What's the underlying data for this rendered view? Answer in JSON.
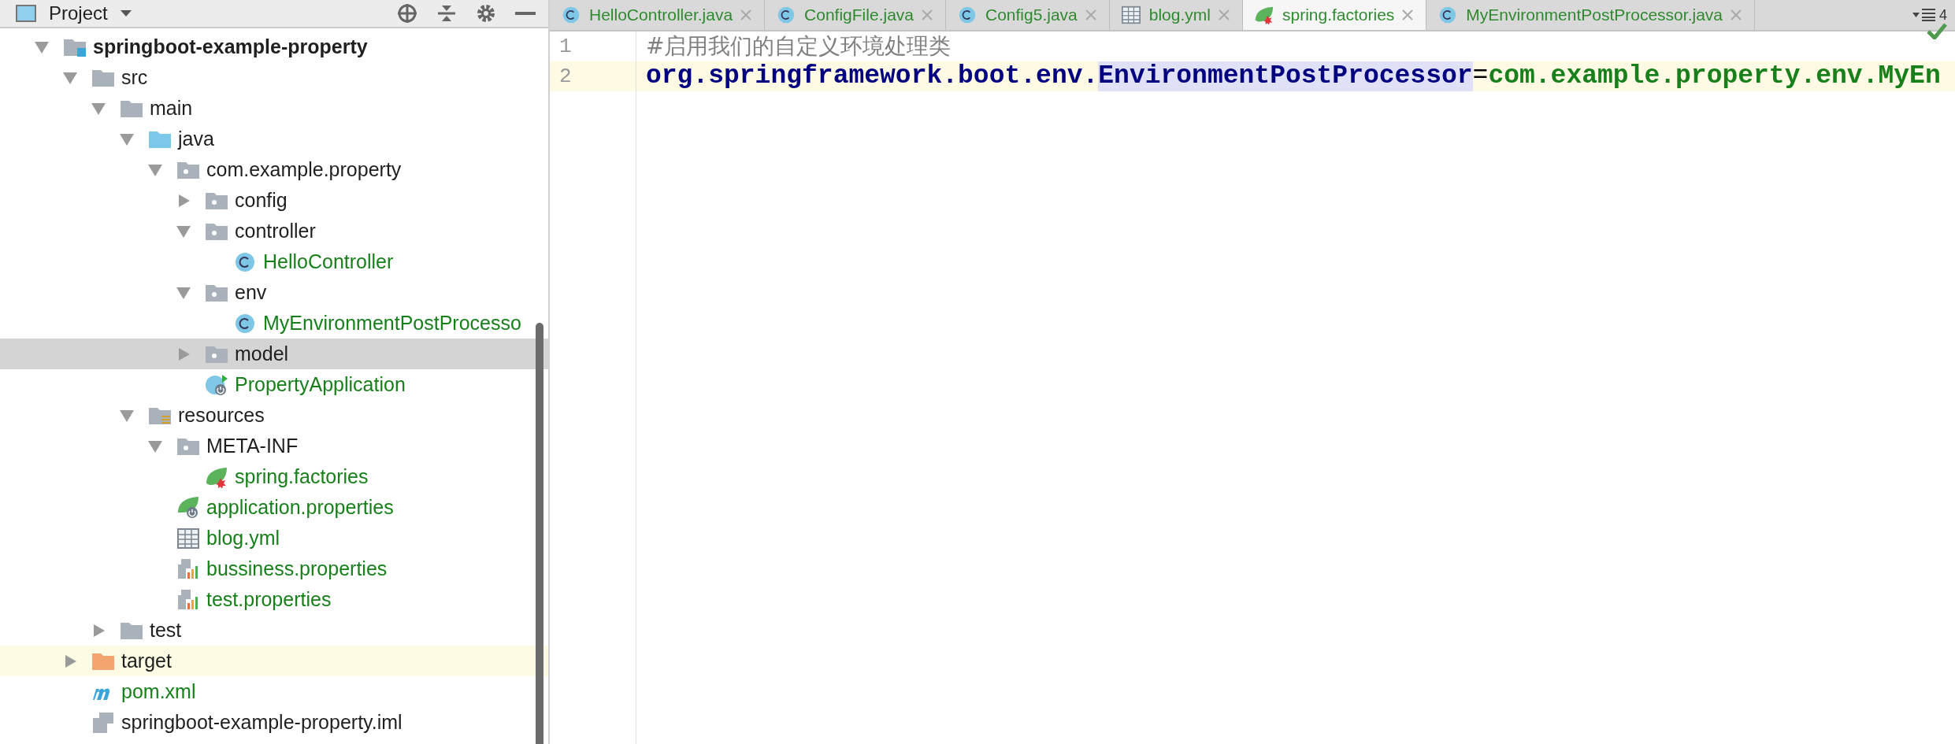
{
  "project_panel": {
    "title": "Project",
    "tree": [
      {
        "label": "springboot-example-property",
        "kind": "module",
        "bold": true,
        "added": false,
        "selected": false,
        "highlighted": false,
        "expanded": true,
        "children": [
          {
            "label": "src",
            "kind": "folder",
            "added": false,
            "selected": false,
            "highlighted": false,
            "expanded": true,
            "children": [
              {
                "label": "main",
                "kind": "folder",
                "added": false,
                "selected": false,
                "highlighted": false,
                "expanded": true,
                "children": [
                  {
                    "label": "java",
                    "kind": "source",
                    "added": false,
                    "selected": false,
                    "highlighted": false,
                    "expanded": true,
                    "children": [
                      {
                        "label": "com.example.property",
                        "kind": "package",
                        "added": false,
                        "selected": false,
                        "highlighted": false,
                        "expanded": true,
                        "children": [
                          {
                            "label": "config",
                            "kind": "package",
                            "added": false,
                            "selected": false,
                            "highlighted": false,
                            "expanded": false
                          },
                          {
                            "label": "controller",
                            "kind": "package",
                            "added": false,
                            "selected": false,
                            "highlighted": false,
                            "expanded": true,
                            "children": [
                              {
                                "label": "HelloController",
                                "kind": "class",
                                "added": true,
                                "selected": false,
                                "highlighted": false
                              }
                            ]
                          },
                          {
                            "label": "env",
                            "kind": "package",
                            "added": false,
                            "selected": false,
                            "highlighted": false,
                            "expanded": true,
                            "children": [
                              {
                                "label": "MyEnvironmentPostProcesso",
                                "kind": "class",
                                "added": true,
                                "selected": false,
                                "highlighted": false
                              }
                            ]
                          },
                          {
                            "label": "model",
                            "kind": "package",
                            "added": false,
                            "selected": true,
                            "highlighted": false,
                            "expanded": false
                          },
                          {
                            "label": "PropertyApplication",
                            "kind": "boot-class",
                            "added": true,
                            "selected": false,
                            "highlighted": false
                          }
                        ]
                      }
                    ]
                  },
                  {
                    "label": "resources",
                    "kind": "resources",
                    "added": false,
                    "selected": false,
                    "highlighted": false,
                    "expanded": true,
                    "children": [
                      {
                        "label": "META-INF",
                        "kind": "package",
                        "added": false,
                        "selected": false,
                        "highlighted": false,
                        "expanded": true,
                        "children": [
                          {
                            "label": "spring.factories",
                            "kind": "spring",
                            "added": true,
                            "selected": false,
                            "highlighted": false
                          }
                        ]
                      },
                      {
                        "label": "application.properties",
                        "kind": "boot-config",
                        "added": true,
                        "selected": false,
                        "highlighted": false
                      },
                      {
                        "label": "blog.yml",
                        "kind": "yaml",
                        "added": true,
                        "selected": false,
                        "highlighted": false
                      },
                      {
                        "label": "bussiness.properties",
                        "kind": "properties",
                        "added": true,
                        "selected": false,
                        "highlighted": false
                      },
                      {
                        "label": "test.properties",
                        "kind": "properties",
                        "added": true,
                        "selected": false,
                        "highlighted": false
                      }
                    ]
                  }
                ]
              },
              {
                "label": "test",
                "kind": "folder",
                "added": false,
                "selected": false,
                "highlighted": false,
                "expanded": false
              }
            ]
          },
          {
            "label": "target",
            "kind": "excluded",
            "added": false,
            "selected": false,
            "highlighted": true,
            "expanded": false
          },
          {
            "label": "pom.xml",
            "kind": "maven",
            "added": true,
            "selected": false,
            "highlighted": false
          },
          {
            "label": "springboot-example-property.iml",
            "kind": "file",
            "added": false,
            "selected": false,
            "highlighted": false
          }
        ]
      }
    ]
  },
  "editor": {
    "tabs": [
      {
        "label": "HelloController.java",
        "kind": "class",
        "selected": false
      },
      {
        "label": "ConfigFile.java",
        "kind": "class",
        "selected": false
      },
      {
        "label": "Config5.java",
        "kind": "class",
        "selected": false
      },
      {
        "label": "blog.yml",
        "kind": "yaml",
        "selected": false
      },
      {
        "label": "spring.factories",
        "kind": "spring",
        "selected": true
      },
      {
        "label": "MyEnvironmentPostProcessor.java",
        "kind": "class",
        "selected": false
      }
    ],
    "tab_overflow_count": "4",
    "lines": [
      {
        "number": "1",
        "current": false,
        "tokens": [
          {
            "kind": "comment",
            "text": "#启用我们的自定义环境处理类"
          }
        ]
      },
      {
        "number": "2",
        "current": true,
        "tokens": [
          {
            "kind": "key",
            "text": "org.springframework.boot.env."
          },
          {
            "kind": "key-match",
            "text": "EnvironmentPostProcessor"
          },
          {
            "kind": "separator",
            "text": "="
          },
          {
            "kind": "value",
            "text": "com.example.property.env.MyEn"
          }
        ]
      }
    ]
  }
}
